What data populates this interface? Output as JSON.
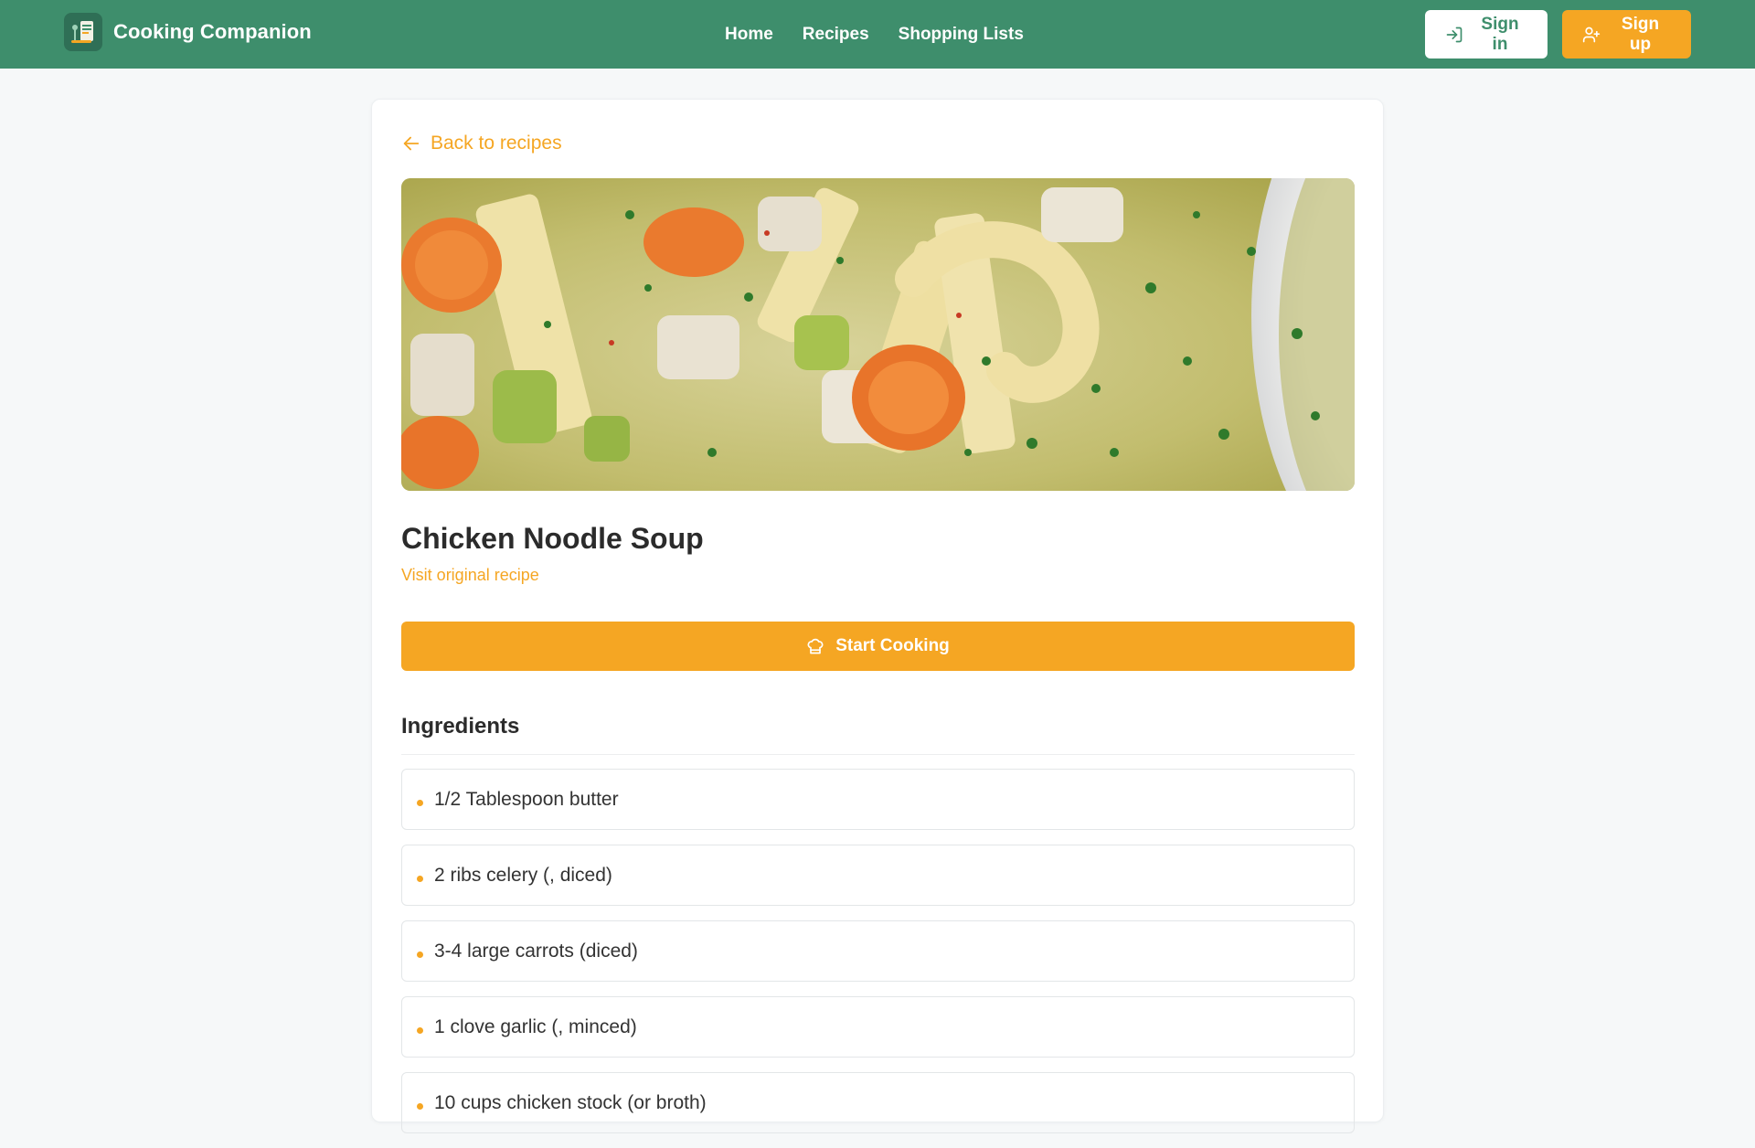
{
  "header": {
    "brand": "Cooking Companion",
    "nav": [
      "Home",
      "Recipes",
      "Shopping Lists"
    ],
    "sign_in": "Sign in",
    "sign_up": "Sign up"
  },
  "recipe": {
    "back_label": "Back to recipes",
    "title": "Chicken Noodle Soup",
    "visit_label": "Visit original recipe",
    "start_label": "Start Cooking",
    "ingredients_heading": "Ingredients",
    "ingredients": [
      "1/2 Tablespoon butter",
      "2 ribs celery (, diced)",
      "3-4 large carrots (diced)",
      "1 clove garlic (, minced)",
      "10 cups chicken stock (or broth)"
    ]
  },
  "colors": {
    "primary_green": "#3e8e6c",
    "accent_orange": "#f5a623"
  }
}
